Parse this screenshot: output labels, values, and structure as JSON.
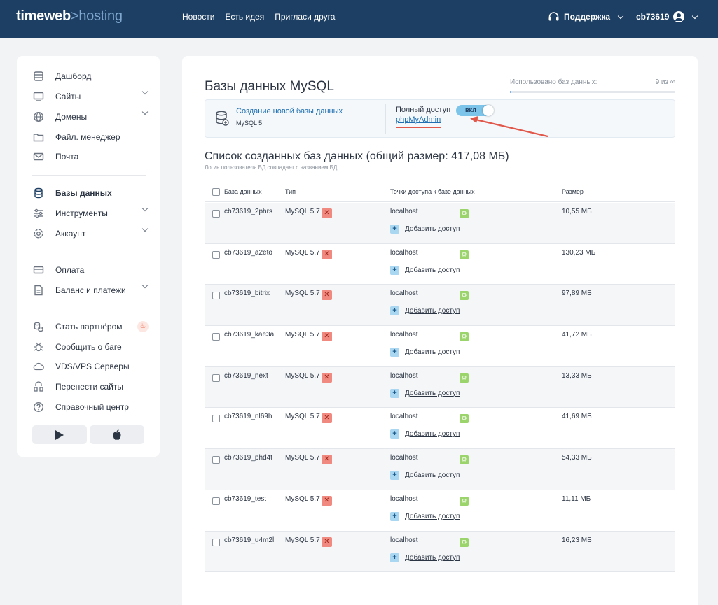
{
  "header": {
    "logo_main": "timeweb",
    "logo_sep": ">",
    "logo_sub": "hosting",
    "nav": [
      "Новости",
      "Есть идея",
      "Пригласи друга"
    ],
    "support": "Поддержка",
    "username": "cb73619"
  },
  "sidebar": {
    "items": [
      {
        "label": "Дашборд",
        "icon": "dashboard-icon"
      },
      {
        "label": "Сайты",
        "icon": "monitor-icon"
      },
      {
        "label": "Домены",
        "icon": "globe-icon"
      },
      {
        "label": "Файл. менеджер",
        "icon": "folder-icon"
      },
      {
        "label": "Почта",
        "icon": "mail-icon"
      },
      {
        "label": "Базы данных",
        "icon": "database-icon"
      },
      {
        "label": "Инструменты",
        "icon": "sliders-icon"
      },
      {
        "label": "Аккаунт",
        "icon": "gear-icon"
      },
      {
        "label": "Оплата",
        "icon": "card-icon"
      },
      {
        "label": "Баланс и платежи",
        "icon": "document-icon"
      },
      {
        "label": "Стать партнёром",
        "icon": "coins-icon"
      },
      {
        "label": "Сообщить о баге",
        "icon": "bug-icon"
      },
      {
        "label": "VDS/VPS Серверы",
        "icon": "cloud-icon"
      },
      {
        "label": "Перенести сайты",
        "icon": "transfer-icon"
      },
      {
        "label": "Справочный центр",
        "icon": "help-icon"
      }
    ]
  },
  "main": {
    "title": "Базы данных MySQL",
    "usage_label": "Использовано баз данных:",
    "usage_count": "9 из ∞",
    "create_link": "Создание новой базы данных",
    "create_sub": "MySQL 5",
    "full_access_label": "Полный доступ",
    "phpmyadmin": "phpMyAdmin",
    "toggle_label": "вкл",
    "list_title": "Список созданных баз данных (общий размер: 417,08 МБ)",
    "list_sub": "Логин пользователя БД совпадает с названием БД",
    "columns": [
      "База данных",
      "Тип",
      "Точки доступа к базе данных",
      "Размер"
    ],
    "add_access": "Добавить доступ",
    "rows": [
      {
        "name": "cb73619_2phrs",
        "type": "MySQL 5.7",
        "host": "localhost",
        "size": "10,55 МБ"
      },
      {
        "name": "cb73619_a2eto",
        "type": "MySQL 5.7",
        "host": "localhost",
        "size": "130,23 МБ"
      },
      {
        "name": "cb73619_bitrix",
        "type": "MySQL 5.7",
        "host": "localhost",
        "size": "97,89 МБ"
      },
      {
        "name": "cb73619_kae3a",
        "type": "MySQL 5.7",
        "host": "localhost",
        "size": "41,72 МБ"
      },
      {
        "name": "cb73619_next",
        "type": "MySQL 5.7",
        "host": "localhost",
        "size": "13,33 МБ"
      },
      {
        "name": "cb73619_nl69h",
        "type": "MySQL 5.7",
        "host": "localhost",
        "size": "41,69 МБ"
      },
      {
        "name": "cb73619_phd4t",
        "type": "MySQL 5.7",
        "host": "localhost",
        "size": "54,33 МБ"
      },
      {
        "name": "cb73619_test",
        "type": "MySQL 5.7",
        "host": "localhost",
        "size": "11,11 МБ"
      },
      {
        "name": "cb73619_u4m2l",
        "type": "MySQL 5.7",
        "host": "localhost",
        "size": "16,23 МБ"
      }
    ]
  },
  "colors": {
    "header_bg": "#1d3f63",
    "link": "#1f6fb2",
    "annotation_red": "#e1574a"
  }
}
